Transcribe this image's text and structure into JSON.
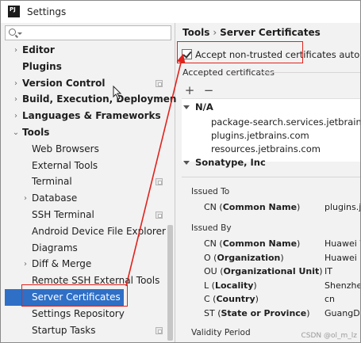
{
  "window": {
    "title": "Settings"
  },
  "search": {
    "placeholder": ""
  },
  "tree": [
    {
      "label": "Editor",
      "bold": true,
      "arrow": "›",
      "indent": 0,
      "proj": false
    },
    {
      "label": "Plugins",
      "bold": true,
      "arrow": "",
      "indent": 0,
      "proj": false
    },
    {
      "label": "Version Control",
      "bold": true,
      "arrow": "›",
      "indent": 0,
      "proj": true
    },
    {
      "label": "Build, Execution, Deployment",
      "bold": true,
      "arrow": "›",
      "indent": 0,
      "proj": false
    },
    {
      "label": "Languages & Frameworks",
      "bold": true,
      "arrow": "›",
      "indent": 0,
      "proj": false
    },
    {
      "label": "Tools",
      "bold": true,
      "arrow": "⌄",
      "indent": 0,
      "proj": false
    },
    {
      "label": "Web Browsers",
      "bold": false,
      "arrow": "",
      "indent": 1,
      "proj": false
    },
    {
      "label": "External Tools",
      "bold": false,
      "arrow": "",
      "indent": 1,
      "proj": false
    },
    {
      "label": "Terminal",
      "bold": false,
      "arrow": "",
      "indent": 1,
      "proj": true
    },
    {
      "label": "Database",
      "bold": false,
      "arrow": "›",
      "indent": 1,
      "proj": false
    },
    {
      "label": "SSH Terminal",
      "bold": false,
      "arrow": "",
      "indent": 1,
      "proj": true
    },
    {
      "label": "Android Device File Explorer",
      "bold": false,
      "arrow": "",
      "indent": 1,
      "proj": false
    },
    {
      "label": "Diagrams",
      "bold": false,
      "arrow": "",
      "indent": 1,
      "proj": false
    },
    {
      "label": "Diff & Merge",
      "bold": false,
      "arrow": "›",
      "indent": 1,
      "proj": false
    },
    {
      "label": "Remote SSH External Tools",
      "bold": false,
      "arrow": "",
      "indent": 1,
      "proj": false
    },
    {
      "label": "Server Certificates",
      "bold": false,
      "arrow": "",
      "indent": 1,
      "proj": false,
      "selected": true
    },
    {
      "label": "Settings Repository",
      "bold": false,
      "arrow": "",
      "indent": 1,
      "proj": false
    },
    {
      "label": "Startup Tasks",
      "bold": false,
      "arrow": "",
      "indent": 1,
      "proj": true
    }
  ],
  "breadcrumb": {
    "parent": "Tools",
    "separator": "›",
    "current": "Server Certificates"
  },
  "accept_checkbox": {
    "label": "Accept non-trusted certificates automatically",
    "checked": true
  },
  "accepted": {
    "label": "Accepted certificates",
    "add": "+",
    "remove": "−",
    "groups": [
      {
        "name": "N/A",
        "hosts": [
          "package-search.services.jetbrains.com",
          "plugins.jetbrains.com",
          "resources.jetbrains.com"
        ]
      },
      {
        "name": "Sonatype, Inc",
        "hosts": []
      }
    ]
  },
  "details": {
    "issued_to": {
      "label": "Issued To",
      "rows": [
        {
          "key_abbr": "CN",
          "key_name": "Common Name",
          "value": "plugins.jetbrains.com"
        }
      ]
    },
    "issued_by": {
      "label": "Issued By",
      "rows": [
        {
          "key_abbr": "CN",
          "key_name": "Common Name",
          "value": "Huawei Web Secure Internet Gateway CA"
        },
        {
          "key_abbr": "O",
          "key_name": "Organization",
          "value": "Huawei"
        },
        {
          "key_abbr": "OU",
          "key_name": "Organizational Unit",
          "value": "IT"
        },
        {
          "key_abbr": "L",
          "key_name": "Locality",
          "value": "Shenzhen"
        },
        {
          "key_abbr": "C",
          "key_name": "Country",
          "value": "cn"
        },
        {
          "key_abbr": "ST",
          "key_name": "State or Province",
          "value": "GuangDong"
        }
      ]
    },
    "validity_label": "Validity Period"
  },
  "watermark": "CSDN @ol_m_lz",
  "colors": {
    "selection": "#2f6fc6",
    "annotation": "#e0231d"
  }
}
